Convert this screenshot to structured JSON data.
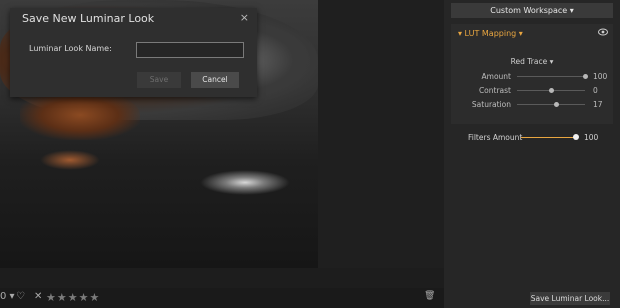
{
  "dialog": {
    "title": "Save New Luminar Look",
    "close_icon": "×",
    "name_label": "Luminar Look Name:",
    "name_value": "",
    "save_label": "Save",
    "cancel_label": "Cancel"
  },
  "bottom_bar": {
    "left_glyph": "0 ▾",
    "heart_icon": "♡",
    "reject_icon": "✕",
    "stars": "★★★★★",
    "trash_icon": "🗑"
  },
  "right_panel": {
    "workspace_label": "Custom Workspace ▾",
    "lut": {
      "title": "▾ LUT Mapping ▾",
      "preset": "Red Trace ▾",
      "sliders": [
        {
          "label": "Amount",
          "value": "100",
          "fraction": 1.0
        },
        {
          "label": "Contrast",
          "value": "0",
          "fraction": 0.5
        },
        {
          "label": "Saturation",
          "value": "17",
          "fraction": 0.585
        }
      ]
    },
    "filters_amount": {
      "label": "Filters Amount",
      "value": "100",
      "fraction": 1.0
    },
    "save_look_label": "Save Luminar Look..."
  },
  "colors": {
    "accent": "#e9a640",
    "panel_bg": "#262626",
    "dialog_bg": "#2f2f2f"
  }
}
